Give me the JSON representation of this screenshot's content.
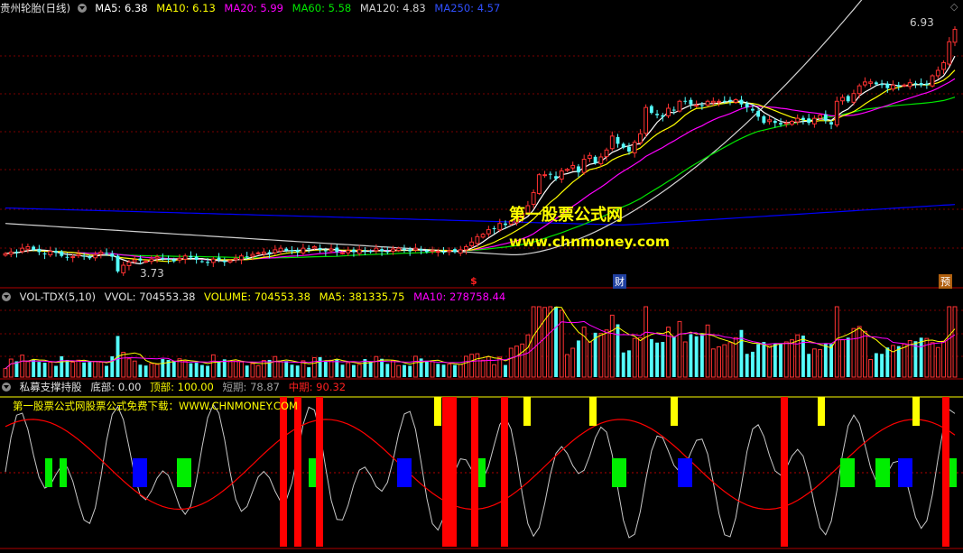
{
  "colors": {
    "up": "#ff3232",
    "down": "#54fcfc",
    "bg": "#000000",
    "grid": "#7a0000",
    "ma5": "#ffffff",
    "ma10": "#ffff00",
    "ma20": "#ff00ff",
    "ma60": "#00e600",
    "ma120": "#d2d2d2",
    "ma250": "#0000ff",
    "yellow": "#ffff00",
    "green": "#00ee00",
    "blue": "#0000ff",
    "red": "#ff0000"
  },
  "price_panel": {
    "stock_name": "贵州轮胎(日线)",
    "ma5": {
      "label": "MA5:",
      "value": "6.38"
    },
    "ma10": {
      "label": "MA10:",
      "value": "6.13"
    },
    "ma20": {
      "label": "MA20:",
      "value": "5.99"
    },
    "ma60": {
      "label": "MA60:",
      "value": "5.58"
    },
    "ma120": {
      "label": "MA120:",
      "value": "4.83"
    },
    "ma250": {
      "label": "MA250:",
      "value": "4.57"
    },
    "high_label": "6.93",
    "low_label": "3.73",
    "event_markers": [
      "$",
      "财",
      "预"
    ]
  },
  "volume_panel": {
    "title": "VOL-TDX(5,10)",
    "vvol": "VVOL: 704553.38",
    "volume": "VOLUME: 704553.38",
    "ma5": "MA5: 381335.75",
    "ma10": "MA10: 278758.44"
  },
  "indicator_panel": {
    "title": "私募支撑持股",
    "bottom": "底部: 0.00",
    "top": "顶部: 100.00",
    "short": "短期: 78.87",
    "mid": "中期: 90.32",
    "watermark": "第一股票公式网股票公式免费下载：WWW.CHNMONEY.COM"
  },
  "watermark": {
    "title": "第一股票公式网",
    "url": "www.chnmoney.com"
  },
  "chart_data": {
    "type": "candlestick",
    "title": "贵州轮胎(日线)",
    "ylim": [
      3.6,
      7.1
    ],
    "low_point": 3.73,
    "high_point": 6.93,
    "closes": [
      4.03,
      4.05,
      4.04,
      4.1,
      4.12,
      4.08,
      4.05,
      4.02,
      4.06,
      4.04,
      4.0,
      3.98,
      3.99,
      4.02,
      4.0,
      3.97,
      4.01,
      4.05,
      4.03,
      3.99,
      3.8,
      3.88,
      3.92,
      3.95,
      3.94,
      3.93,
      3.96,
      3.99,
      3.97,
      3.95,
      3.93,
      3.97,
      4.0,
      3.98,
      3.95,
      3.93,
      3.91,
      3.96,
      3.95,
      3.92,
      3.94,
      3.97,
      4.0,
      3.99,
      4.02,
      4.04,
      4.05,
      4.03,
      4.08,
      4.1,
      4.07,
      4.06,
      4.05,
      4.1,
      4.09,
      4.12,
      4.08,
      4.06,
      4.09,
      4.05,
      4.04,
      4.07,
      4.05,
      4.08,
      4.06,
      4.05,
      4.1,
      4.06,
      4.05,
      4.09,
      4.1,
      4.08,
      4.06,
      4.1,
      4.07,
      4.05,
      4.07,
      4.06,
      4.05,
      4.07,
      4.05,
      4.08,
      4.12,
      4.18,
      4.25,
      4.28,
      4.34,
      4.35,
      4.42,
      4.4,
      4.45,
      4.5,
      4.55,
      4.65,
      4.82,
      5.05,
      5.05,
      5.05,
      5.0,
      5.1,
      5.12,
      5.17,
      5.08,
      5.25,
      5.3,
      5.2,
      5.28,
      5.37,
      5.55,
      5.45,
      5.4,
      5.35,
      5.47,
      5.58,
      5.92,
      5.85,
      5.82,
      5.8,
      5.91,
      5.88,
      6.0,
      6.0,
      5.96,
      5.95,
      5.94,
      6.0,
      6.0,
      6.0,
      6.0,
      6.0,
      6.02,
      5.96,
      5.92,
      5.88,
      5.8,
      5.72,
      5.76,
      5.72,
      5.7,
      5.72,
      5.74,
      5.78,
      5.76,
      5.72,
      5.78,
      5.82,
      5.75,
      5.7,
      6.0,
      6.05,
      6.0,
      6.1,
      6.2,
      6.25,
      6.25,
      6.22,
      6.21,
      6.17,
      6.21,
      6.19,
      6.21,
      6.24,
      6.23,
      6.21,
      6.21,
      6.33,
      6.4,
      6.5,
      6.77,
      6.93
    ]
  }
}
